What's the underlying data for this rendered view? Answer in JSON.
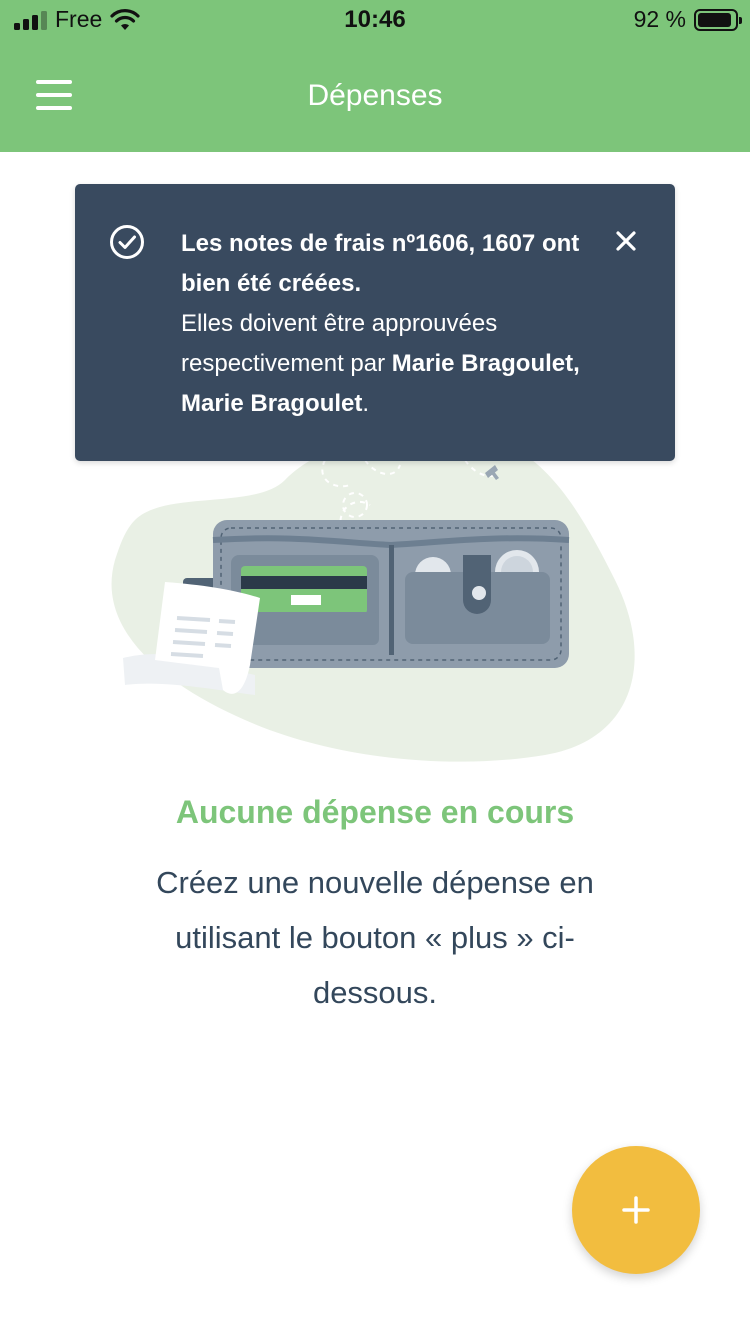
{
  "status_bar": {
    "carrier": "Free",
    "time": "10:46",
    "battery": "92 %",
    "battery_level": 0.92,
    "icons": [
      "signal-icon",
      "wifi-icon",
      "battery-icon"
    ]
  },
  "app_bar": {
    "title": "Dépenses",
    "menu_icon": "hamburger-menu-icon"
  },
  "toast": {
    "icon": "check-circle-icon",
    "close_icon": "close-icon",
    "line1_bold": "Les notes de frais nº1606, 1607 ont bien été créées.",
    "line2_prefix": "Elles doivent être approuvées respectivement par ",
    "approvers": "Marie Bragoulet, Marie Bragoulet",
    "line2_suffix": "."
  },
  "empty_state": {
    "illustration": "wallet-illustration",
    "title": "Aucune dépense en cours",
    "description": "Créez une nouvelle dépense en utilisant le bouton « plus » ci-dessous."
  },
  "fab": {
    "icon": "plus-icon"
  },
  "colors": {
    "primary": "#7dc57a",
    "toast_bg": "#394a5f",
    "fab": "#f2bd3f",
    "text": "#33475b"
  }
}
